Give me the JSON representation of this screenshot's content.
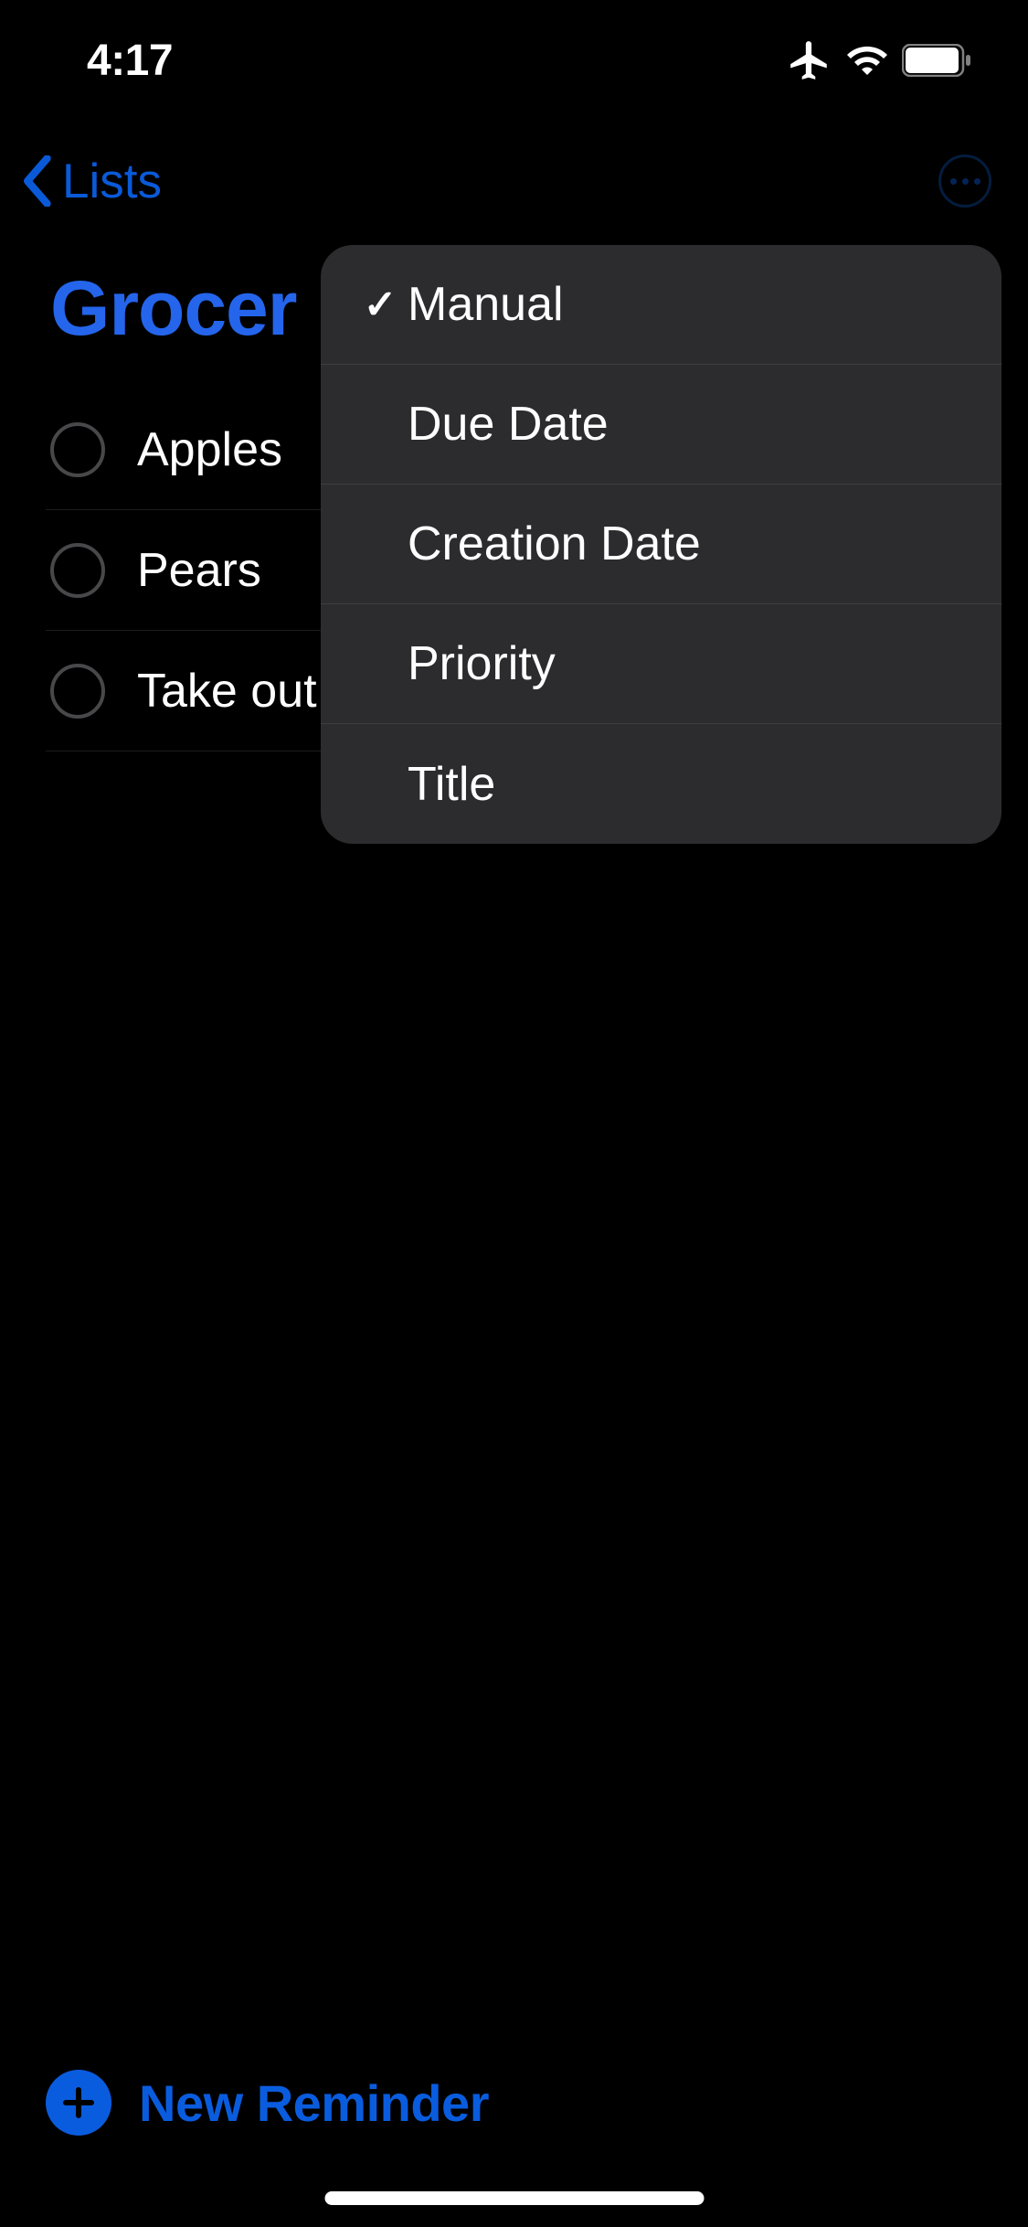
{
  "statusBar": {
    "time": "4:17"
  },
  "nav": {
    "backLabel": "Lists"
  },
  "list": {
    "title": "Grocer",
    "items": [
      {
        "label": "Apples"
      },
      {
        "label": "Pears"
      },
      {
        "label": "Take out"
      }
    ]
  },
  "sortMenu": {
    "options": [
      {
        "label": "Manual",
        "selected": true
      },
      {
        "label": "Due Date",
        "selected": false
      },
      {
        "label": "Creation Date",
        "selected": false
      },
      {
        "label": "Priority",
        "selected": false
      },
      {
        "label": "Title",
        "selected": false
      }
    ]
  },
  "bottom": {
    "newReminderLabel": "New Reminder"
  }
}
